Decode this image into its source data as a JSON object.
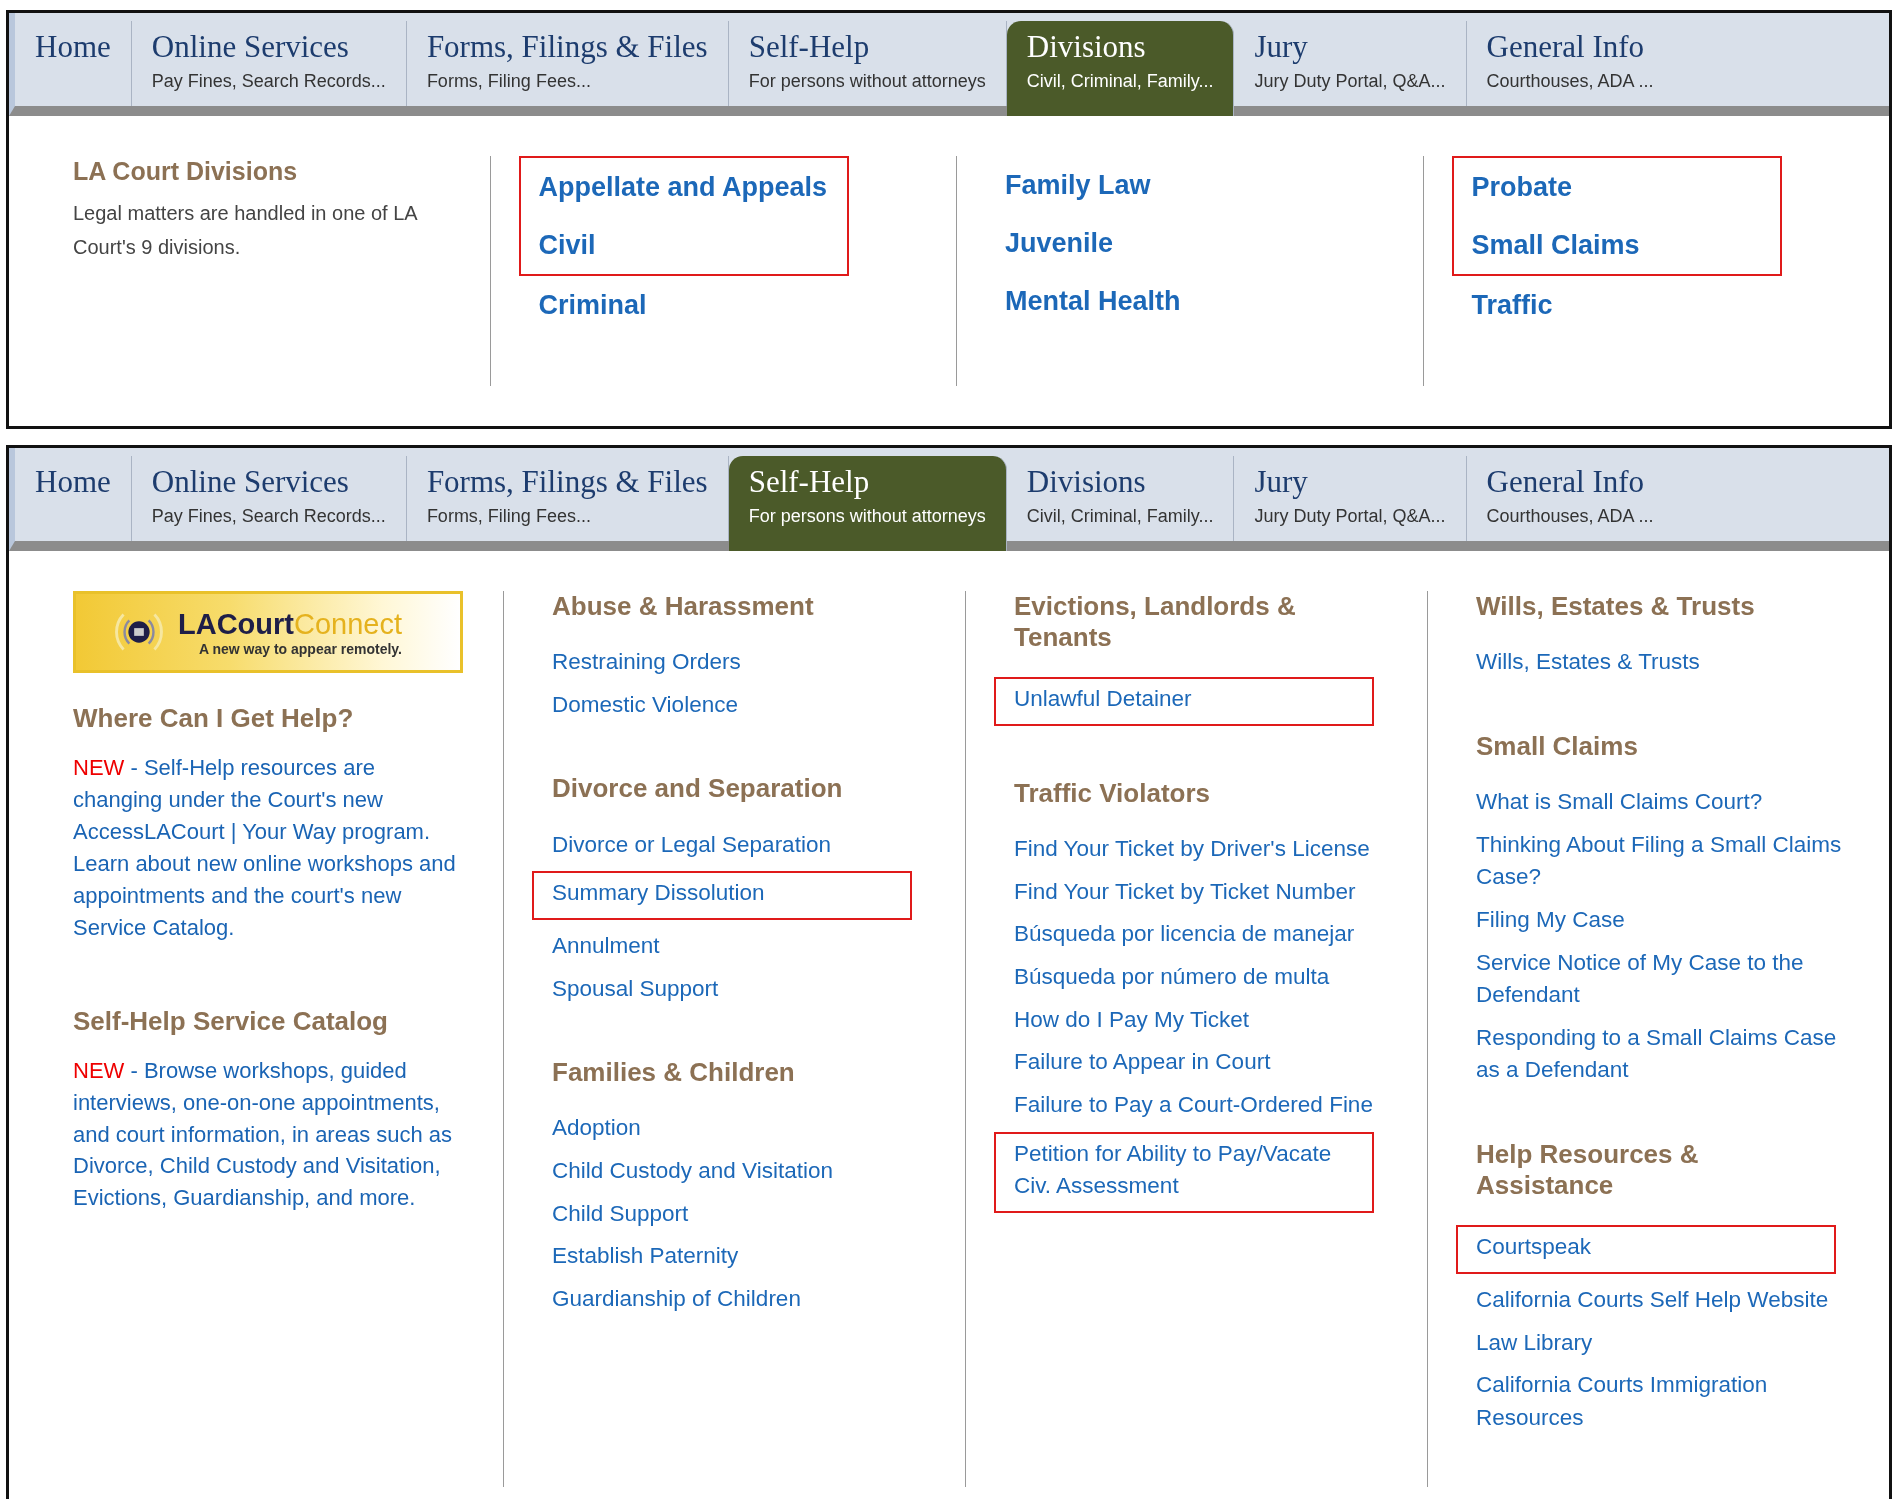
{
  "panels": [
    {
      "kind": "divisions",
      "tabs": [
        {
          "title": "Home",
          "selected": false
        },
        {
          "title": "Online Services",
          "subtitle": "Pay Fines, Search Records...",
          "selected": false
        },
        {
          "title": "Forms, Filings & Files",
          "subtitle": "Forms, Filing Fees...",
          "selected": false
        },
        {
          "title": "Self-Help",
          "subtitle": "For persons without attorneys",
          "selected": false
        },
        {
          "title": "Divisions",
          "subtitle": "Civil, Criminal, Family...",
          "selected": true
        },
        {
          "title": "Jury",
          "subtitle": "Jury Duty Portal, Q&A...",
          "selected": false
        },
        {
          "title": "General Info",
          "subtitle": "Courthouses, ADA ...",
          "selected": false
        }
      ],
      "intro": [
        {
          "kind": "heading",
          "text": "LA Court Divisions"
        },
        {
          "kind": "note",
          "text": "Legal matters are handled in one of LA Court's 9 divisions."
        }
      ],
      "columns": [
        [
          {
            "links": [
              {
                "label": "Appellate and Appeals",
                "highlighted": true
              },
              {
                "label": "Civil",
                "highlighted": true
              },
              {
                "label": "Criminal",
                "highlighted": false
              }
            ]
          }
        ],
        [
          {
            "links": [
              {
                "label": "Family Law",
                "highlighted": false
              },
              {
                "label": "Juvenile",
                "highlighted": false
              },
              {
                "label": "Mental Health",
                "highlighted": false
              }
            ]
          }
        ],
        [
          {
            "links": [
              {
                "label": "Probate",
                "highlighted": true
              },
              {
                "label": "Small Claims",
                "highlighted": true
              },
              {
                "label": "Traffic",
                "highlighted": false
              }
            ]
          }
        ]
      ]
    },
    {
      "kind": "self-help",
      "tabs": [
        {
          "title": "Home",
          "selected": false
        },
        {
          "title": "Online Services",
          "subtitle": "Pay Fines, Search Records...",
          "selected": false
        },
        {
          "title": "Forms, Filings & Files",
          "subtitle": "Forms, Filing Fees...",
          "selected": false
        },
        {
          "title": "Self-Help",
          "subtitle": "For persons without attorneys",
          "selected": true
        },
        {
          "title": "Divisions",
          "subtitle": "Civil, Criminal, Family...",
          "selected": false
        },
        {
          "title": "Jury",
          "subtitle": "Jury Duty Portal, Q&A...",
          "selected": false
        },
        {
          "title": "General Info",
          "subtitle": "Courthouses, ADA ...",
          "selected": false
        }
      ],
      "intro": [
        {
          "kind": "banner",
          "brand_primary": "LACourt",
          "brand_secondary": "Connect",
          "tagline": "A new way to appear remotely."
        },
        {
          "kind": "heading",
          "text": "Where Can I Get Help?"
        },
        {
          "kind": "news",
          "badge": "NEW",
          "text": "- Self-Help resources are changing under the Court's new AccessLACourt | Your Way program. Learn about new online workshops and appointments and the court's new Service Catalog."
        },
        {
          "kind": "heading",
          "text": "Self-Help Service Catalog"
        },
        {
          "kind": "news",
          "badge": "NEW",
          "text": "- Browse workshops, guided interviews, one-on-one appointments, and court information, in areas such as Divorce, Child Custody and Visitation, Evictions, Guardianship, and more."
        }
      ],
      "columns": [
        [
          {
            "heading": "Abuse & Harassment",
            "links": [
              {
                "label": "Restraining Orders",
                "highlighted": false
              },
              {
                "label": "Domestic Violence",
                "highlighted": false
              }
            ]
          },
          {
            "heading": "Divorce and Separation",
            "links": [
              {
                "label": "Divorce or Legal Separation",
                "highlighted": false
              },
              {
                "label": "Summary Dissolution",
                "highlighted": true
              },
              {
                "label": "Annulment",
                "highlighted": false
              },
              {
                "label": "Spousal Support",
                "highlighted": false
              }
            ]
          },
          {
            "heading": "Families & Children",
            "links": [
              {
                "label": "Adoption",
                "highlighted": false
              },
              {
                "label": "Child Custody and Visitation",
                "highlighted": false
              },
              {
                "label": "Child Support",
                "highlighted": false
              },
              {
                "label": "Establish Paternity",
                "highlighted": false
              },
              {
                "label": "Guardianship of Children",
                "highlighted": false
              }
            ]
          }
        ],
        [
          {
            "heading": "Evictions, Landlords & Tenants",
            "links": [
              {
                "label": "Unlawful Detainer",
                "highlighted": true
              }
            ]
          },
          {
            "heading": "Traffic Violators",
            "links": [
              {
                "label": "Find Your Ticket by Driver's License",
                "highlighted": false
              },
              {
                "label": "Find Your Ticket by Ticket Number",
                "highlighted": false
              },
              {
                "label": "Búsqueda por licencia de manejar",
                "highlighted": false
              },
              {
                "label": "Búsqueda por número de multa",
                "highlighted": false
              },
              {
                "label": "How do I Pay My Ticket",
                "highlighted": false
              },
              {
                "label": "Failure to Appear in Court",
                "highlighted": false
              },
              {
                "label": "Failure to Pay a Court-Ordered Fine",
                "highlighted": false
              },
              {
                "label": "Petition for Ability to Pay/Vacate Civ. Assessment",
                "highlighted": true
              }
            ]
          }
        ],
        [
          {
            "heading": "Wills, Estates & Trusts",
            "links": [
              {
                "label": "Wills, Estates & Trusts",
                "highlighted": false
              }
            ]
          },
          {
            "heading": "Small Claims",
            "links": [
              {
                "label": "What is Small Claims Court?",
                "highlighted": false
              },
              {
                "label": "Thinking About Filing a Small Claims Case?",
                "highlighted": false
              },
              {
                "label": "Filing My Case",
                "highlighted": false
              },
              {
                "label": "Service Notice of My Case to the Defendant",
                "highlighted": false
              },
              {
                "label": "Responding to a Small Claims Case as a Defendant",
                "highlighted": false
              }
            ]
          },
          {
            "heading": "Help Resources & Assistance",
            "links": [
              {
                "label": "Courtspeak",
                "highlighted": true
              },
              {
                "label": "California Courts Self Help Website",
                "highlighted": false
              },
              {
                "label": "Law Library",
                "highlighted": false
              },
              {
                "label": "California Courts Immigration Resources",
                "highlighted": false
              }
            ]
          }
        ]
      ]
    }
  ]
}
